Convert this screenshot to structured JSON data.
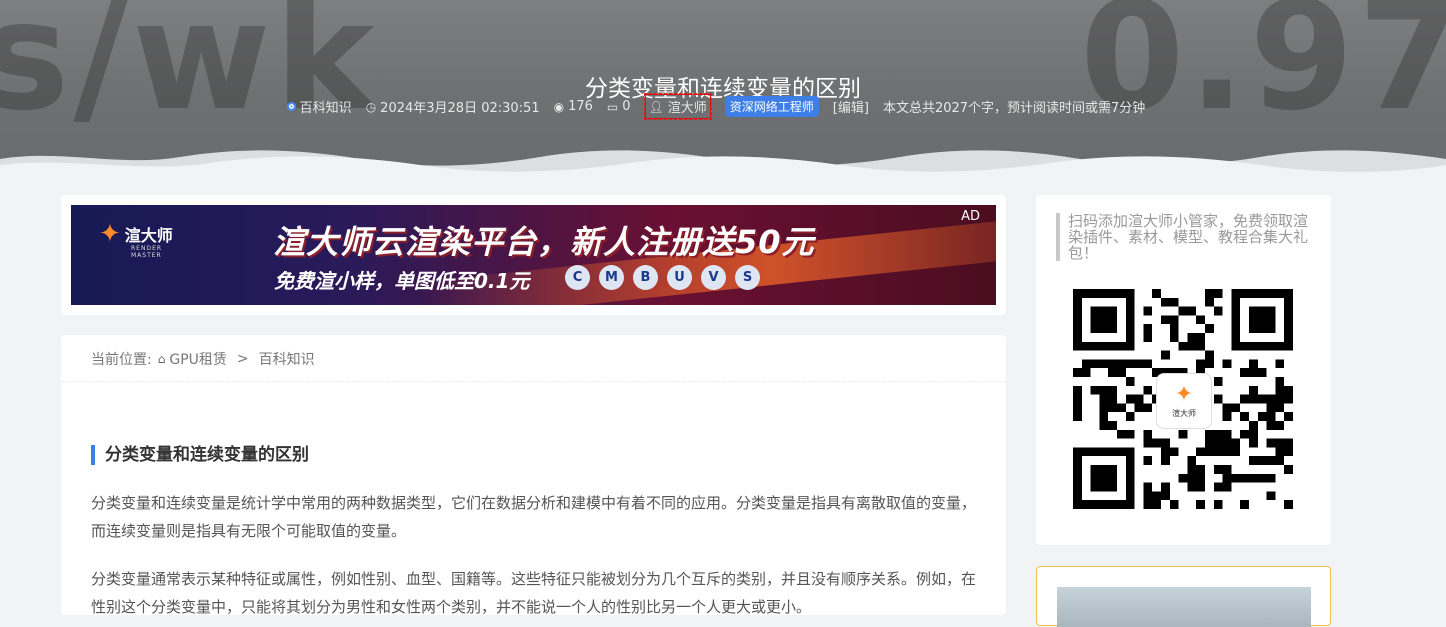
{
  "hero": {
    "bg_text_left": "s/wk",
    "bg_text_right": "0.97 (",
    "title": "分类变量和连续变量的区别",
    "meta": {
      "category": "百科知识",
      "datetime": "2024年3月28日 02:30:51",
      "views": "176",
      "comments": "0",
      "author": "渲大师",
      "author_role": "资深网络工程师",
      "edit": "[编辑]",
      "reading_info": "本文总共2027个字，预计阅读时间或需7分钟"
    }
  },
  "ad": {
    "logo_text": "渲大师",
    "logo_sub": "RENDER MASTER",
    "headline": "渲大师云渲染平台，新人注册送50元",
    "subline": "免费渲小样，单图低至0.1元",
    "tag": "AD",
    "software_icons": [
      "C",
      "M",
      "B",
      "U",
      "V",
      "S"
    ]
  },
  "breadcrumb": {
    "prefix": "当前位置:",
    "home": "GPU租赁",
    "separator": ">",
    "current": "百科知识"
  },
  "article": {
    "section_title": "分类变量和连续变量的区别",
    "paragraphs": [
      "分类变量和连续变量是统计学中常用的两种数据类型，它们在数据分析和建模中有着不同的应用。分类变量是指具有离散取值的变量，而连续变量则是指具有无限个可能取值的变量。",
      "分类变量通常表示某种特征或属性，例如性别、血型、国籍等。这些特征只能被划分为几个互斥的类别，并且没有顺序关系。例如，在性别这个分类变量中，只能将其划分为男性和女性两个类别，并不能说一个人的性别比另一个人更大或更小。"
    ]
  },
  "sidebar": {
    "promo_text": "扫码添加渲大师小管家，免费领取渲染插件、素材、模型、教程合集大礼包！",
    "qr_logo_label": "渲大师"
  },
  "colors": {
    "accent": "#3d7ee8",
    "hero_bg": "#727374",
    "page_bg": "#f1f3f4"
  }
}
